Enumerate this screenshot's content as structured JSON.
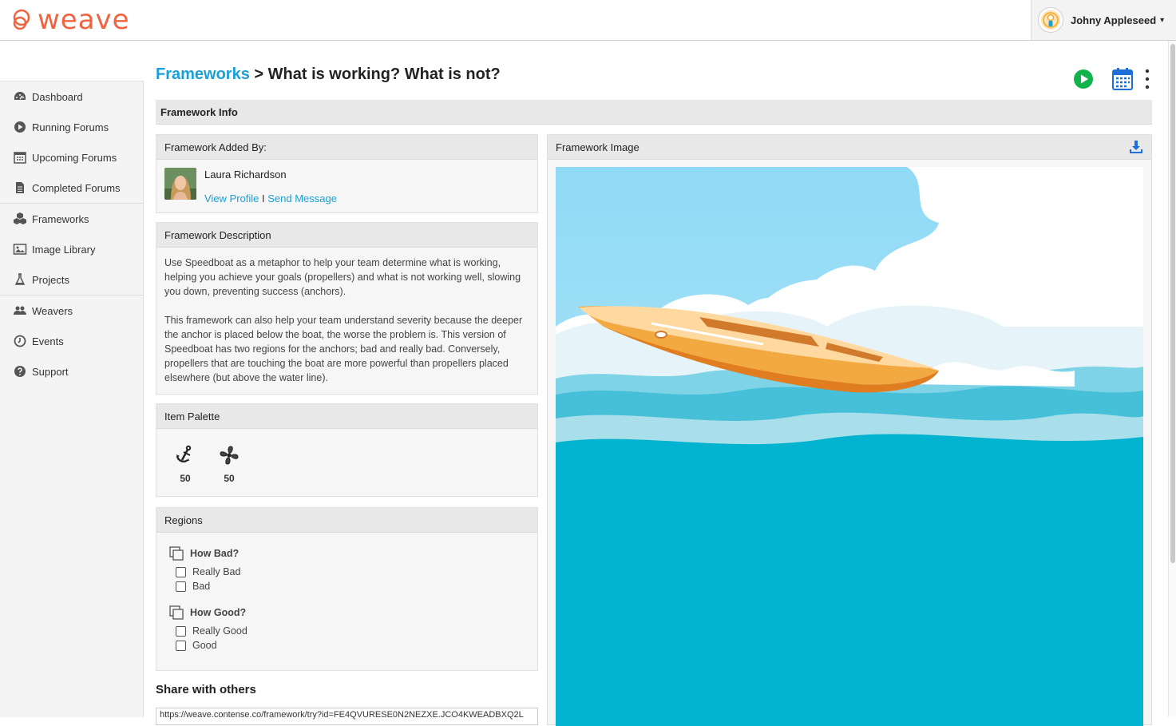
{
  "app": {
    "logo_text": "weave",
    "brand_color": "#f0633f",
    "accent_color": "#1aa0d8"
  },
  "user": {
    "name": "Johny Appleseed",
    "caret": "▾"
  },
  "sidebar": {
    "items": [
      {
        "label": "Dashboard",
        "icon": "dashboard-icon"
      },
      {
        "label": "Running Forums",
        "icon": "play-circle-icon"
      },
      {
        "label": "Upcoming Forums",
        "icon": "calendar-icon"
      },
      {
        "label": "Completed Forums",
        "icon": "document-icon"
      },
      {
        "label": "Frameworks",
        "icon": "cubes-icon"
      },
      {
        "label": "Image Library",
        "icon": "image-icon"
      },
      {
        "label": "Projects",
        "icon": "flask-icon"
      },
      {
        "label": "Weavers",
        "icon": "users-icon"
      },
      {
        "label": "Events",
        "icon": "clock-icon"
      },
      {
        "label": "Support",
        "icon": "help-icon"
      }
    ]
  },
  "header": {
    "breadcrumb_link": "Frameworks",
    "separator": " > ",
    "title": "What is working? What is not?"
  },
  "framework_info": {
    "label": "Framework Info"
  },
  "added_by": {
    "heading": "Framework Added By:",
    "name": "Laura Richardson",
    "view_profile": "View Profile",
    "divider": " I ",
    "send_message": "Send Message"
  },
  "description": {
    "heading": "Framework Description",
    "para1": "Use Speedboat as a metaphor to help your team determine what is working, helping you achieve your goals (propellers) and what is not working well, slowing you down, preventing success (anchors).",
    "para2": "This framework can also help your team understand severity because the deeper the anchor is placed below the boat, the worse the problem is. This version of Speedboat has two regions for the anchors; bad and really bad. Conversely, propellers that are touching the boat are more powerful than propellers placed elsewhere (but above the water line)."
  },
  "palette": {
    "heading": "Item Palette",
    "items": [
      {
        "icon": "anchor-icon",
        "count": "50"
      },
      {
        "icon": "propeller-icon",
        "count": "50"
      }
    ]
  },
  "regions": {
    "heading": "Regions",
    "groups": [
      {
        "title": "How Bad?",
        "options": [
          "Really Bad",
          "Bad"
        ]
      },
      {
        "title": "How Good?",
        "options": [
          "Really Good",
          "Good"
        ]
      }
    ]
  },
  "share": {
    "title": "Share with others",
    "url": "https://weave.contense.co/framework/try?id=FE4QVURESE0N2NEZXE.JCO4KWEADBXQ2L"
  },
  "image_panel": {
    "heading": "Framework Image"
  }
}
